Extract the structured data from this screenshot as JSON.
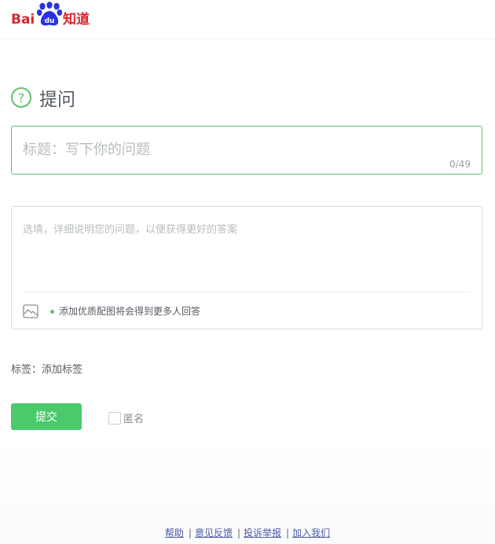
{
  "header": {
    "logo_bai": "Bai",
    "logo_du": "du",
    "logo_zhidao": "知道",
    "logo_colors": {
      "red": "#d8272d",
      "blue": "#2932e1"
    }
  },
  "page": {
    "icon": "question-circle-icon",
    "title": "提问"
  },
  "question_title": {
    "value": "",
    "placeholder": "标题：写下你的问题",
    "char_count": "0/49"
  },
  "detail": {
    "value": "",
    "placeholder": "选填，详细说明您的问题，以便获得更好的答案",
    "image_icon": "image-icon",
    "hint": "添加优质配图将会得到更多人回答"
  },
  "tags": {
    "label": "标签：",
    "add": "添加标签"
  },
  "actions": {
    "submit": "提交",
    "anonymous": "匿名",
    "anonymous_checked": false
  },
  "footer": {
    "links": [
      "帮助",
      "意见反馈",
      "投诉举报",
      "加入我们"
    ],
    "separator": "|"
  },
  "colors": {
    "accent": "#4bca6c",
    "border_active": "#5cc274",
    "link": "#4a5aa8"
  }
}
